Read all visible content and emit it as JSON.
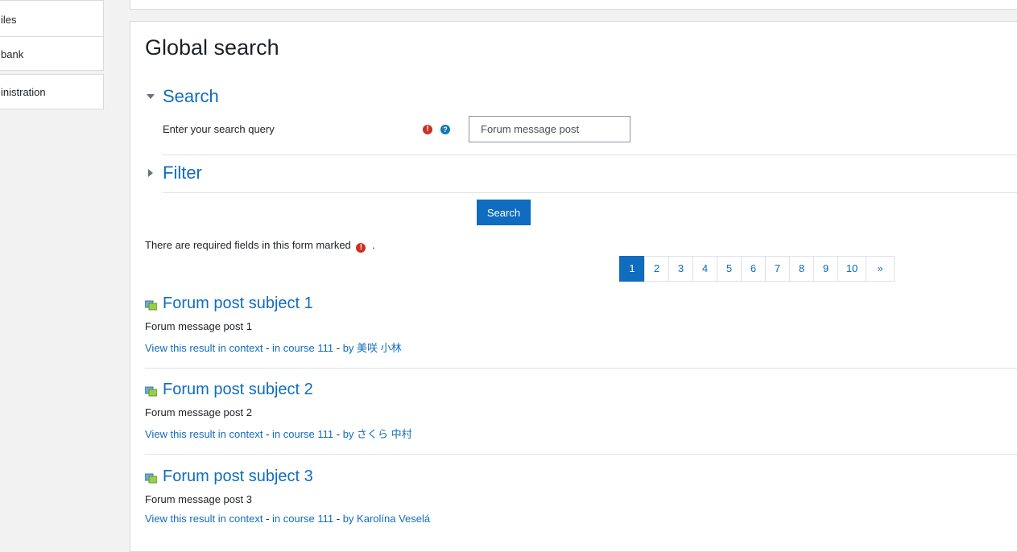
{
  "sidebar": {
    "items": [
      {
        "label": "iles"
      },
      {
        "label": "bank"
      },
      {
        "label": "inistration"
      }
    ]
  },
  "page": {
    "title": "Global search"
  },
  "search_section": {
    "heading": "Search",
    "query_label": "Enter your search query",
    "query_value": "Forum message post",
    "required_icon": "exclamation-icon",
    "help_icon": "question-icon"
  },
  "filter_section": {
    "heading": "Filter"
  },
  "form": {
    "submit_label": "Search",
    "required_note": "There are required fields in this form marked",
    "required_note_suffix": "."
  },
  "pagination": {
    "pages": [
      "1",
      "2",
      "3",
      "4",
      "5",
      "6",
      "7",
      "8",
      "9",
      "10"
    ],
    "next": "»",
    "current": "1"
  },
  "results": [
    {
      "title": "Forum post subject 1",
      "content": "Forum message post 1",
      "context_link": "View this result in context",
      "course_link": "in course 111",
      "author_link": "by 美咲 小林"
    },
    {
      "title": "Forum post subject 2",
      "content": "Forum message post 2",
      "context_link": "View this result in context",
      "course_link": "in course 111",
      "author_link": "by さくら 中村"
    },
    {
      "title": "Forum post subject 3",
      "content": "Forum message post 3",
      "context_link": "View this result in context",
      "course_link": "in course 111",
      "author_link": "by Karolína Veselá"
    }
  ],
  "colors": {
    "accent": "#0f6cbf",
    "required": "#ca3120",
    "help": "#1177b5"
  }
}
